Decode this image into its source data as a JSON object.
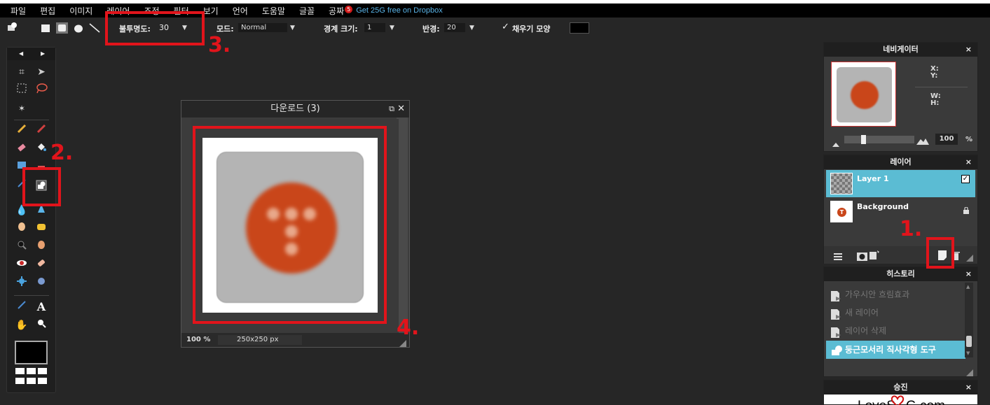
{
  "menu": {
    "items": [
      "파일",
      "편집",
      "이미지",
      "레이어",
      "조정",
      "필터",
      "보기",
      "언어",
      "도움말",
      "글꼴",
      "공짜"
    ],
    "badge": "5",
    "promo": "Get 25G free on Dropbox"
  },
  "options": {
    "opacity_label": "불투명도:",
    "opacity_value": "30",
    "mode_label": "모드:",
    "mode_value": "Normal",
    "border_label": "경계 크기:",
    "border_value": "1",
    "radius_label": "반경:",
    "radius_value": "20",
    "fill_label": "채우기 모양",
    "fill_checked": true
  },
  "image_window": {
    "title": "다운로드 (3)",
    "zoom": "100",
    "zoom_unit": "%",
    "size": "250x250 px"
  },
  "navigator": {
    "title": "네비게이터",
    "x_label": "X:",
    "y_label": "Y:",
    "w_label": "W:",
    "h_label": "H:",
    "zoom_value": "100",
    "zoom_unit": "%"
  },
  "layers": {
    "title": "레이어",
    "items": [
      {
        "name": "Layer 1",
        "selected": true,
        "checked": true
      },
      {
        "name": "Background",
        "selected": false,
        "locked": true
      }
    ]
  },
  "history": {
    "title": "히스토리",
    "items": [
      "가우시안 흐림효과",
      "새 레이어",
      "레이어 삭제",
      "둥근모서리 직사각형 도구"
    ]
  },
  "ad_panel": {
    "title": "승진",
    "logo_text": "LoveSOG.com"
  },
  "annotations": [
    "1.",
    "2.",
    "3.",
    "4."
  ],
  "colors": {
    "accent_red": "#e1141b",
    "layer_selected": "#5bbcd3",
    "logo_orange": "#c9461a",
    "background": "#262626"
  }
}
